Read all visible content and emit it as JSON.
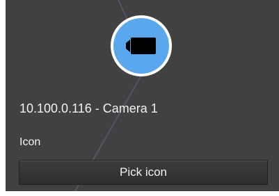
{
  "device": {
    "name": "10.100.0.116 - Camera 1",
    "icon": "video-camera-icon",
    "icon_background_color": "#5aa7ee"
  },
  "icon_section": {
    "label": "Icon",
    "pick_button_label": "Pick icon"
  },
  "colors": {
    "panel_background": "#414141",
    "text": "#f2f2f2"
  }
}
